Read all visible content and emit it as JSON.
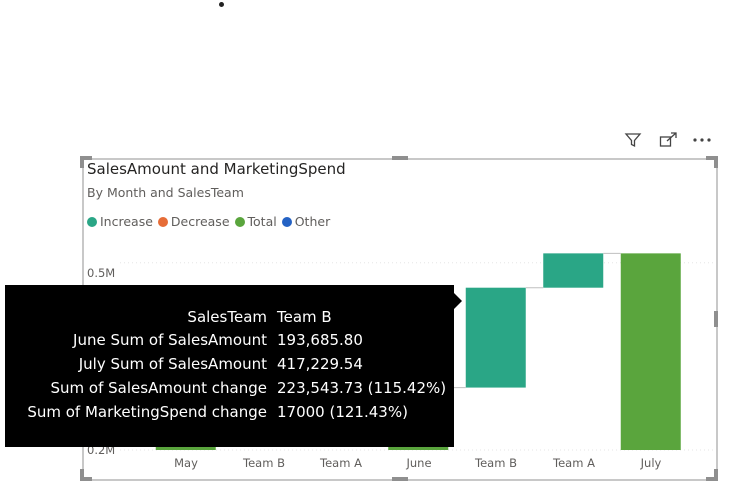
{
  "visual": {
    "title": "SalesAmount and MarketingSpend",
    "subtitle": "By Month and SalesTeam"
  },
  "toolbar": {
    "filter_icon": "filter-icon",
    "focus_icon": "focus-mode-icon",
    "more_icon": "more-options-icon"
  },
  "legend": [
    {
      "label": "Increase",
      "color": "#2aa686"
    },
    {
      "label": "Decrease",
      "color": "#e66c37"
    },
    {
      "label": "Total",
      "color": "#5aa53d"
    },
    {
      "label": "Other",
      "color": "#2462c4"
    }
  ],
  "chart_data": {
    "type": "bar",
    "subtype": "waterfall",
    "title": "SalesAmount and MarketingSpend",
    "subtitle": "By Month and SalesTeam",
    "categories": [
      "May",
      "Team B",
      "Team A",
      "June",
      "Team B",
      "Team A",
      "July"
    ],
    "kinds": [
      "total",
      "increase",
      "increase",
      "total",
      "increase",
      "increase",
      "total"
    ],
    "bars": [
      {
        "category": "May",
        "kind": "total",
        "start": 0,
        "end": 0.215
      },
      {
        "category": "Team B",
        "kind": "increase",
        "start": null,
        "end": null
      },
      {
        "category": "Team A",
        "kind": "increase",
        "start": null,
        "end": null
      },
      {
        "category": "June",
        "kind": "total",
        "start": 0,
        "end": 0.3
      },
      {
        "category": "Team B",
        "kind": "increase",
        "start": 0.3,
        "end": 0.46
      },
      {
        "category": "Team A",
        "kind": "increase",
        "start": 0.46,
        "end": 0.515
      },
      {
        "category": "July",
        "kind": "total",
        "start": 0,
        "end": 0.515
      }
    ],
    "yticks": [
      "0.5M",
      "0.2M"
    ],
    "ylim": [
      0.2,
      0.53
    ],
    "grid": true,
    "legend_position": "top-left"
  },
  "tooltip": {
    "rows": [
      {
        "label": "SalesTeam",
        "value": "Team B"
      },
      {
        "label": "June Sum of SalesAmount",
        "value": "193,685.80"
      },
      {
        "label": "July Sum of SalesAmount",
        "value": "417,229.54"
      },
      {
        "label": "Sum of SalesAmount change",
        "value": "223,543.73 (115.42%)"
      },
      {
        "label": "Sum of MarketingSpend change",
        "value": "17000 (121.43%)"
      }
    ]
  }
}
